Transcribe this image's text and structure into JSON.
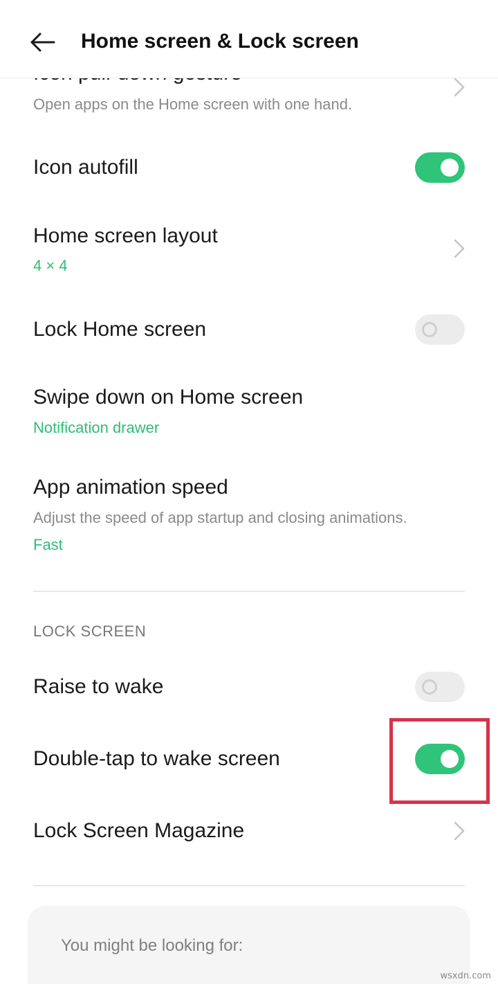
{
  "header": {
    "title": "Home screen & Lock screen",
    "back_icon": "arrow-left-icon"
  },
  "items": {
    "icon_pull_down": {
      "title": "Icon pull-down gesture",
      "subtitle": "Open apps on the Home screen with one hand."
    },
    "icon_autofill": {
      "title": "Icon autofill",
      "enabled": true
    },
    "home_layout": {
      "title": "Home screen layout",
      "value": "4 × 4"
    },
    "lock_home": {
      "title": "Lock Home screen",
      "enabled": false
    },
    "swipe_down": {
      "title": "Swipe down on Home screen",
      "value": "Notification drawer"
    },
    "app_animation": {
      "title": "App animation speed",
      "subtitle": "Adjust the speed of app startup and closing animations.",
      "value": "Fast"
    }
  },
  "lock_section": {
    "label": "LOCK SCREEN",
    "raise_to_wake": {
      "title": "Raise to wake",
      "enabled": false
    },
    "double_tap": {
      "title": "Double-tap to wake screen",
      "enabled": true
    },
    "magazine": {
      "title": "Lock Screen Magazine"
    }
  },
  "suggestions": {
    "label": "You might be looking for:"
  },
  "watermark": "wsxdn.com",
  "colors": {
    "accent": "#2fbc77",
    "toggle_on": "#2fc47a",
    "highlight": "#d6334a"
  }
}
